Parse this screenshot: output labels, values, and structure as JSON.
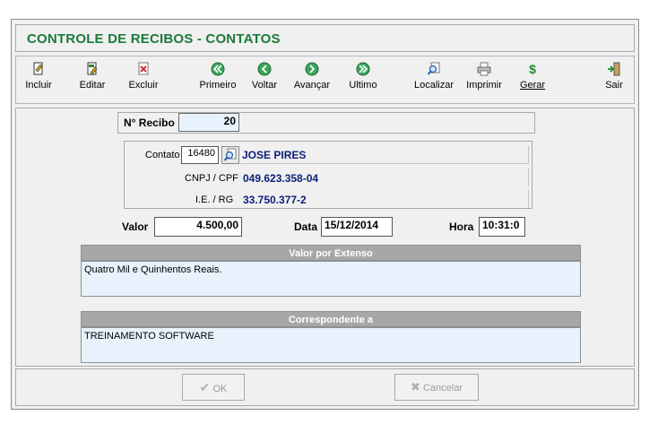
{
  "window": {
    "title": "CONTROLE DE RECIBOS - CONTATOS"
  },
  "toolbar": {
    "incluir": "Incluir",
    "editar": "Editar",
    "excluir": "Excluir",
    "primeiro": "Primeiro",
    "voltar": "Voltar",
    "avancar": "Avançar",
    "ultimo": "Ultimo",
    "localizar": "Localizar",
    "imprimir": "Imprimir",
    "gerar": "Gerar",
    "sair": "Sair"
  },
  "form": {
    "recibo_label": "N° Recibo",
    "recibo_value": "20",
    "contato_label": "Contato",
    "contato_code": "16480",
    "contato_name": "JOSE PIRES",
    "cnpj_label": "CNPJ / CPF",
    "cnpj_value": "049.623.358-04",
    "ie_label": "I.E. / RG",
    "ie_value": "33.750.377-2",
    "valor_label": "Valor",
    "valor_value": "4.500,00",
    "data_label": "Data",
    "data_value": "15/12/2014",
    "hora_label": "Hora",
    "hora_value": "10:31:0",
    "extenso_header": "Valor por Extenso",
    "extenso_text": "Quatro Mil e Quinhentos Reais.",
    "corresp_header": "Correspondente a",
    "corresp_text": "TREINAMENTO SOFTWARE"
  },
  "footer": {
    "ok": "OK",
    "cancelar": "Cancelar"
  },
  "colors": {
    "title_green": "#1c7a3a",
    "value_blue": "#0b1e7a",
    "memo_bg": "#e8f2fc",
    "header_gray": "#a7a7a7"
  }
}
